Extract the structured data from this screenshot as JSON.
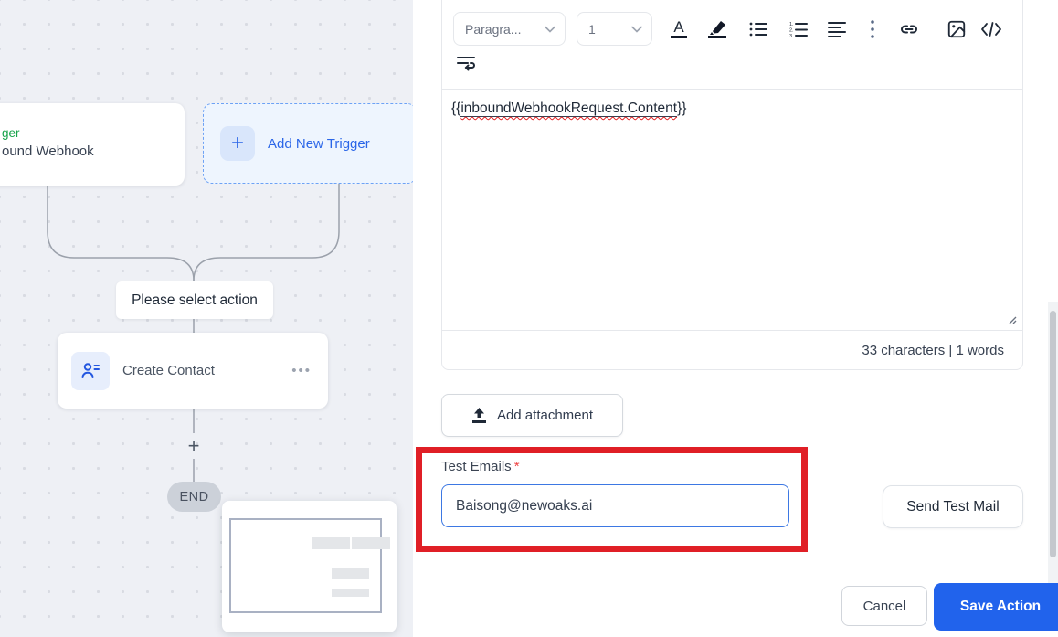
{
  "canvas": {
    "trigger_card": {
      "type_label": "ger",
      "name_label": "ound Webhook"
    },
    "add_trigger_button": {
      "plus": "+",
      "label": "Add New Trigger"
    },
    "select_action_hint": "Please select action",
    "action_card": {
      "label": "Create Contact",
      "menu_dots": "•••"
    },
    "add_step_plus": "+",
    "end_badge": "END"
  },
  "editor": {
    "toolbar": {
      "paragraph_dropdown": "Paragra...",
      "size_dropdown": "1",
      "color_letter": "A",
      "code_glyph": "</>"
    },
    "content": {
      "open_braces": "{{",
      "merge_tag": "inboundWebhookRequest.Content",
      "close_braces": "}}"
    },
    "stats": "33 characters | 1 words"
  },
  "attachment": {
    "add_label": "Add attachment"
  },
  "test_email": {
    "label": "Test Emails",
    "required_mark": "*",
    "value": "Baisong@newoaks.ai",
    "send_button": "Send Test Mail"
  },
  "footer_actions": {
    "cancel": "Cancel",
    "save": "Save Action"
  },
  "colors": {
    "accent_blue": "#2163ec",
    "annotation_red": "#e01f26",
    "trigger_green": "#16a34a",
    "canvas_bg": "#eef0f5"
  }
}
